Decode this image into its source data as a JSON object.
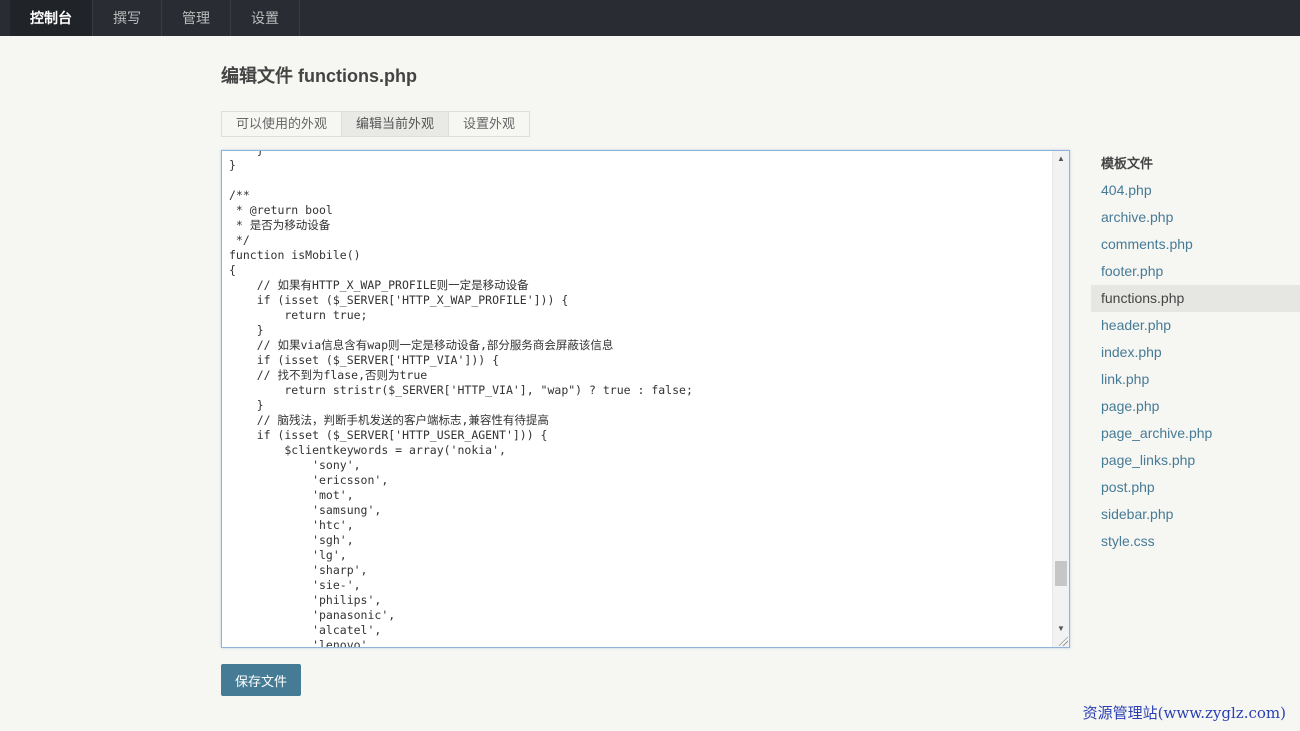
{
  "nav": {
    "items": [
      {
        "label": "控制台",
        "active": true
      },
      {
        "label": "撰写",
        "active": false
      },
      {
        "label": "管理",
        "active": false
      },
      {
        "label": "设置",
        "active": false
      }
    ]
  },
  "page": {
    "title": "编辑文件 functions.php"
  },
  "tabs": [
    {
      "label": "可以使用的外观",
      "current": false
    },
    {
      "label": "编辑当前外观",
      "current": true
    },
    {
      "label": "设置外观",
      "current": false
    }
  ],
  "editor": {
    "scroll_up_glyph": "▲",
    "scroll_down_glyph": "▼",
    "code": "    }\n}\n\n/**\n * @return bool\n * 是否为移动设备\n */\nfunction isMobile()\n{\n    // 如果有HTTP_X_WAP_PROFILE则一定是移动设备\n    if (isset ($_SERVER['HTTP_X_WAP_PROFILE'])) {\n        return true;\n    }\n    // 如果via信息含有wap则一定是移动设备,部分服务商会屏蔽该信息\n    if (isset ($_SERVER['HTTP_VIA'])) {\n    // 找不到为flase,否则为true\n        return stristr($_SERVER['HTTP_VIA'], \"wap\") ? true : false;\n    }\n    // 脑残法，判断手机发送的客户端标志,兼容性有待提高\n    if (isset ($_SERVER['HTTP_USER_AGENT'])) {\n        $clientkeywords = array('nokia',\n            'sony',\n            'ericsson',\n            'mot',\n            'samsung',\n            'htc',\n            'sgh',\n            'lg',\n            'sharp',\n            'sie-',\n            'philips',\n            'panasonic',\n            'alcatel',\n            'lenovo',"
  },
  "save_button": {
    "label": "保存文件"
  },
  "sidebar": {
    "title": "模板文件",
    "files": [
      {
        "label": "404.php",
        "current": false
      },
      {
        "label": "archive.php",
        "current": false
      },
      {
        "label": "comments.php",
        "current": false
      },
      {
        "label": "footer.php",
        "current": false
      },
      {
        "label": "functions.php",
        "current": true
      },
      {
        "label": "header.php",
        "current": false
      },
      {
        "label": "index.php",
        "current": false
      },
      {
        "label": "link.php",
        "current": false
      },
      {
        "label": "page.php",
        "current": false
      },
      {
        "label": "page_archive.php",
        "current": false
      },
      {
        "label": "page_links.php",
        "current": false
      },
      {
        "label": "post.php",
        "current": false
      },
      {
        "label": "sidebar.php",
        "current": false
      },
      {
        "label": "style.css",
        "current": false
      }
    ]
  },
  "watermark": {
    "text": "资源管理站(www.zyglz.com)"
  },
  "colors": {
    "topbar": "#292d33",
    "accent": "#467b96",
    "background": "#f6f6f3"
  }
}
